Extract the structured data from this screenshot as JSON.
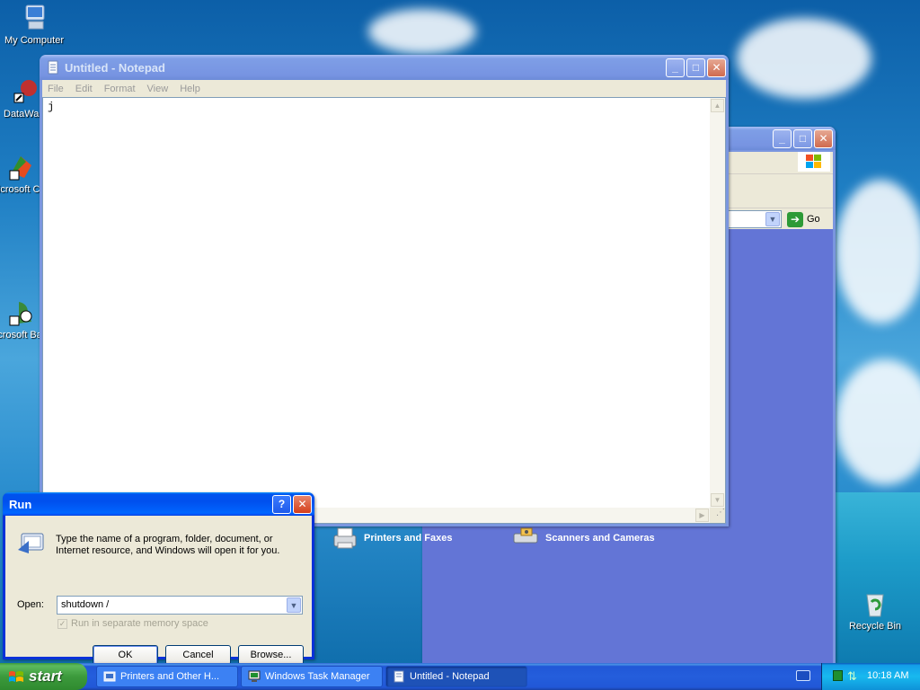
{
  "desktop": {
    "icons": [
      {
        "label": "My Computer"
      },
      {
        "label": "DataWa"
      },
      {
        "label": "Microsoft C++"
      },
      {
        "label": "Microsoft Basic"
      },
      {
        "label": "Recycle Bin"
      }
    ]
  },
  "notepad": {
    "title": "Untitled - Notepad",
    "menu": [
      "File",
      "Edit",
      "Format",
      "View",
      "Help"
    ],
    "content": "j"
  },
  "explorer": {
    "go_label": "Go",
    "items": [
      {
        "label": "Printers and Faxes"
      },
      {
        "label": "Scanners and Cameras"
      }
    ]
  },
  "run_dialog": {
    "title": "Run",
    "description": "Type the name of a program, folder, document, or Internet resource, and Windows will open it for you.",
    "open_label": "Open:",
    "open_value": "shutdown /",
    "checkbox_label": "Run in separate memory space",
    "ok_label": "OK",
    "cancel_label": "Cancel",
    "browse_label": "Browse..."
  },
  "taskbar": {
    "start_label": "start",
    "tasks": [
      {
        "label": "Printers and Other H..."
      },
      {
        "label": "Windows Task Manager"
      },
      {
        "label": "Untitled - Notepad"
      }
    ],
    "clock": "10:18 AM"
  }
}
